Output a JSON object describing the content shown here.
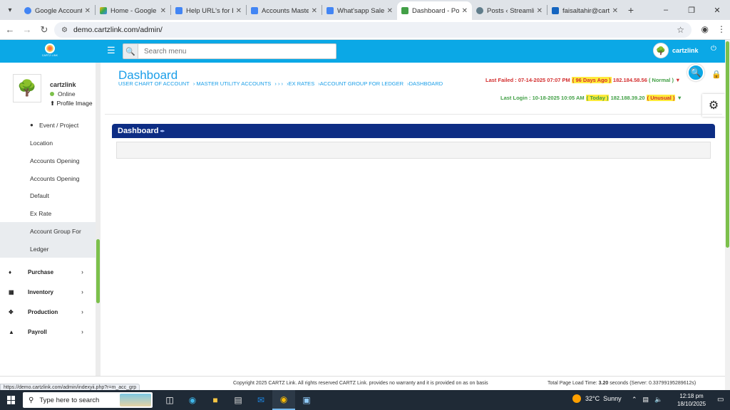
{
  "browser": {
    "tabs": [
      {
        "label": "Google Accounts",
        "color": "#4285f4",
        "active": false
      },
      {
        "label": "Home - Google D",
        "color": "#fbbc04",
        "active": false
      },
      {
        "label": "Help URL's for ER",
        "color": "#4285f4",
        "active": false
      },
      {
        "label": "Accounts Master",
        "color": "#4285f4",
        "active": false
      },
      {
        "label": "What'sapp Sales R",
        "color": "#4285f4",
        "active": false
      },
      {
        "label": "Dashboard - Pow",
        "color": "#43a047",
        "active": true
      },
      {
        "label": "Posts ‹ Streamline",
        "color": "#607d8b",
        "active": false
      },
      {
        "label": "faisaltahir@cartzl",
        "color": "#1565c0",
        "active": false
      }
    ],
    "url": "demo.cartzlink.com/admin/",
    "status_url": "https://demo.cartzlink.com/admin/indexyii.php?r=m_acc_grp"
  },
  "header": {
    "search_placeholder": "Search menu",
    "username": "cartzlink",
    "logo_text": "CARTZ LINK"
  },
  "sidebar": {
    "profile_name": "cartzlink",
    "status": "Online",
    "profile_image_label": "Profile Image",
    "items": [
      {
        "label": "Event / Project"
      },
      {
        "label": "Location"
      },
      {
        "label": "Accounts Opening"
      },
      {
        "label": "Accounts Opening"
      },
      {
        "label": "Default"
      },
      {
        "label": "Ex Rate"
      },
      {
        "label": "Account Group For"
      },
      {
        "label": "Ledger"
      }
    ],
    "groups": [
      {
        "label": "Purchase"
      },
      {
        "label": "Inventory"
      },
      {
        "label": "Production"
      },
      {
        "label": "Payroll"
      }
    ]
  },
  "main": {
    "title": "Dashboard",
    "breadcrumb": [
      "USER CHART OF ACCOUNT",
      "› MASTER UTILITY ACCOUNTS",
      "› › ›",
      "›EX RATES",
      "›ACCOUNT GROUP FOR LEDGER",
      "›DASHBOARD"
    ],
    "last_failed": {
      "prefix": "Last Failed : 07-14-2025 07:07 PM",
      "ago": "( 96 Days Ago )",
      "ip": "182.184.58.56",
      "status": "( Normal )"
    },
    "last_login": {
      "prefix": "Last Login : 10-18-2025 10:05 AM",
      "ago": "( Today )",
      "ip": "182.188.39.20",
      "status": "( Unusual )"
    },
    "panel_title": "Dashboard"
  },
  "footer": {
    "copyright": "Copyright 2025 CARTZ Link. All rights reserved CARTZ Link. provides no warranty and it is provided on as on basis",
    "load_label": "Total Page Load Time:",
    "load_value": "3.20",
    "load_suffix": "seconds (Server: 0.33799195289612s)"
  },
  "taskbar": {
    "search_placeholder": "Type here to search",
    "weather_temp": "32°C",
    "weather_desc": "Sunny",
    "time": "12:18 pm",
    "date": "18/10/2025"
  }
}
